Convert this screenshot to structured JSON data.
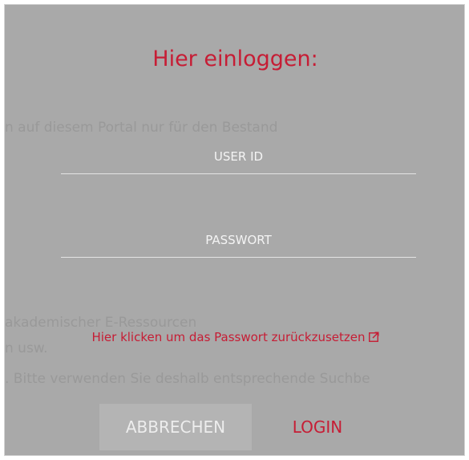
{
  "background": {
    "line1": "n auf diesem Portal nur für den Bestand",
    "line2": "akademischer E-Ressourcen",
    "line3": "n usw.",
    "line4": ". Bitte verwenden Sie deshalb entsprechende Suchbe"
  },
  "login_dialog": {
    "title": "Hier einloggen:",
    "user_id_placeholder": "USER ID",
    "password_placeholder": "PASSWORT",
    "reset_link": "Hier klicken um das Passwort zurückzusetzen",
    "cancel_label": "ABBRECHEN",
    "login_label": "LOGIN"
  },
  "colors": {
    "accent": "#c61d35",
    "overlay": "#a9a9a9"
  },
  "icons": {
    "reset_link_icon": "external-link-icon"
  }
}
